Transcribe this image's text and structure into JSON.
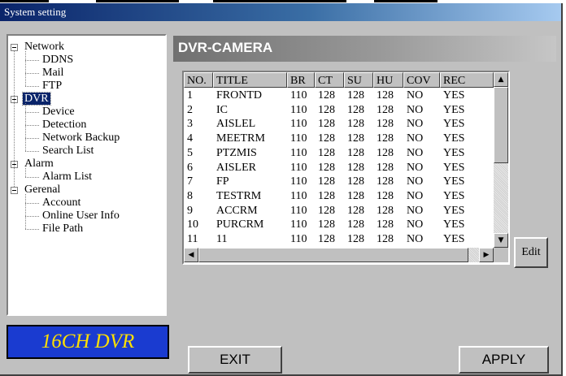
{
  "window": {
    "title": "System setting"
  },
  "tree": {
    "items": [
      {
        "label": "Network",
        "level": 0,
        "expanded": true,
        "selected": false
      },
      {
        "label": "DDNS",
        "level": 1,
        "selected": false
      },
      {
        "label": "Mail",
        "level": 1,
        "selected": false
      },
      {
        "label": "FTP",
        "level": 1,
        "selected": false
      },
      {
        "label": "DVR",
        "level": 0,
        "expanded": true,
        "selected": true
      },
      {
        "label": "Device",
        "level": 1,
        "selected": false
      },
      {
        "label": "Detection",
        "level": 1,
        "selected": false
      },
      {
        "label": "Network Backup",
        "level": 1,
        "selected": false
      },
      {
        "label": "Search List",
        "level": 1,
        "selected": false
      },
      {
        "label": "Alarm",
        "level": 0,
        "expanded": true,
        "selected": false
      },
      {
        "label": "Alarm List",
        "level": 1,
        "selected": false
      },
      {
        "label": "Gerenal",
        "level": 0,
        "expanded": true,
        "selected": false
      },
      {
        "label": "Account",
        "level": 1,
        "selected": false
      },
      {
        "label": "Online User Info",
        "level": 1,
        "selected": false
      },
      {
        "label": "File Path",
        "level": 1,
        "selected": false
      }
    ]
  },
  "logo": {
    "text": "16CH DVR"
  },
  "section": {
    "heading": "DVR-CAMERA"
  },
  "table": {
    "columns": [
      "NO.",
      "TITLE",
      "BR",
      "CT",
      "SU",
      "HU",
      "COV",
      "REC"
    ],
    "rows": [
      [
        "1",
        "FRONTD",
        "110",
        "128",
        "128",
        "128",
        "NO",
        "YES"
      ],
      [
        "2",
        "IC",
        "110",
        "128",
        "128",
        "128",
        "NO",
        "YES"
      ],
      [
        "3",
        "AISLEL",
        "110",
        "128",
        "128",
        "128",
        "NO",
        "YES"
      ],
      [
        "4",
        "MEETRM",
        "110",
        "128",
        "128",
        "128",
        "NO",
        "YES"
      ],
      [
        "5",
        "PTZMIS",
        "110",
        "128",
        "128",
        "128",
        "NO",
        "YES"
      ],
      [
        "6",
        "AISLER",
        "110",
        "128",
        "128",
        "128",
        "NO",
        "YES"
      ],
      [
        "7",
        "FP",
        "110",
        "128",
        "128",
        "128",
        "NO",
        "YES"
      ],
      [
        "8",
        "TESTRM",
        "110",
        "128",
        "128",
        "128",
        "NO",
        "YES"
      ],
      [
        "9",
        "ACCRM",
        "110",
        "128",
        "128",
        "128",
        "NO",
        "YES"
      ],
      [
        "10",
        "PURCRM",
        "110",
        "128",
        "128",
        "128",
        "NO",
        "YES"
      ],
      [
        "11",
        "11",
        "110",
        "128",
        "128",
        "128",
        "NO",
        "YES"
      ]
    ]
  },
  "buttons": {
    "edit": "Edit",
    "exit": "EXIT",
    "apply": "APPLY"
  },
  "icons": {
    "scroll_up": "scroll-up-arrow-icon",
    "scroll_down": "scroll-down-arrow-icon",
    "scroll_left": "scroll-left-arrow-icon",
    "scroll_right": "scroll-right-arrow-icon",
    "tree_expander": "minus-box-icon"
  },
  "colors": {
    "title_bar": "#0a246a",
    "logo_bg": "#1a3bd0",
    "logo_text": "#ffe000",
    "selection": "#0a246a"
  }
}
